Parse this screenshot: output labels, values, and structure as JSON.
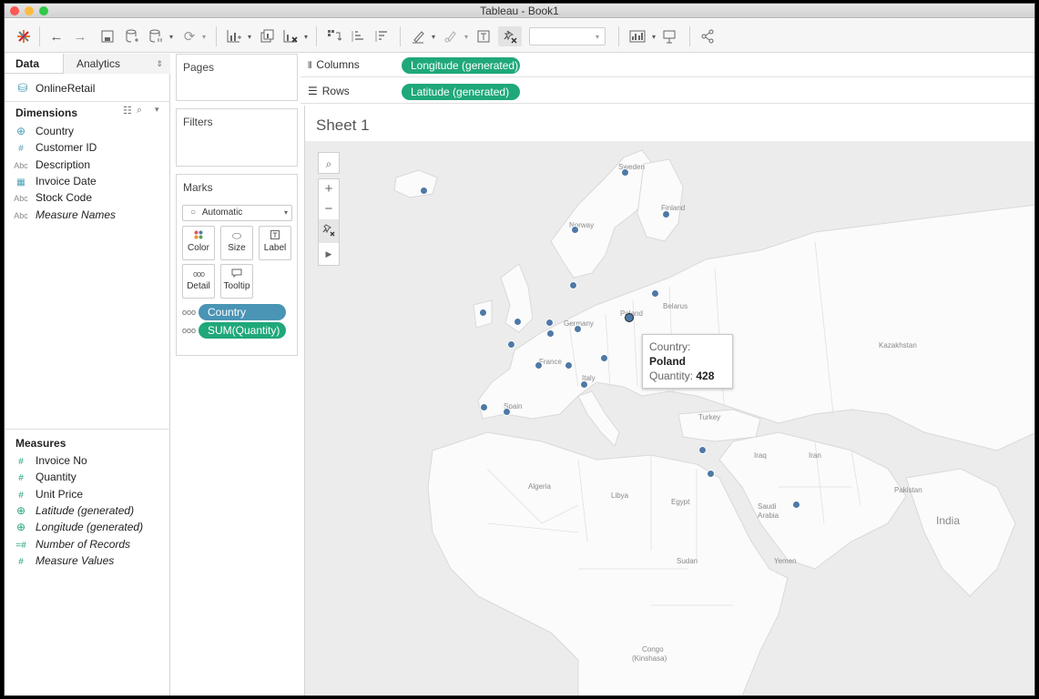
{
  "window": {
    "title": "Tableau - Book1"
  },
  "left": {
    "tabs": {
      "data": "Data",
      "analytics": "Analytics"
    },
    "datasource": "OnlineRetail",
    "dimensions_title": "Dimensions",
    "dimensions": [
      {
        "icon": "globe-icon",
        "type": "⊕",
        "label": "Country",
        "italic": false
      },
      {
        "icon": "number-icon",
        "type": "#",
        "label": "Customer ID",
        "italic": false
      },
      {
        "icon": "text-icon",
        "type": "Abc",
        "label": "Description",
        "italic": false
      },
      {
        "icon": "date-icon",
        "type": "▦",
        "label": "Invoice Date",
        "italic": false
      },
      {
        "icon": "text-icon",
        "type": "Abc",
        "label": "Stock Code",
        "italic": false
      },
      {
        "icon": "text-icon",
        "type": "Abc",
        "label": "Measure Names",
        "italic": true
      }
    ],
    "measures_title": "Measures",
    "measures": [
      {
        "icon": "number-icon",
        "type": "#",
        "label": "Invoice No",
        "italic": false
      },
      {
        "icon": "number-icon",
        "type": "#",
        "label": "Quantity",
        "italic": false
      },
      {
        "icon": "number-icon",
        "type": "#",
        "label": "Unit Price",
        "italic": false
      },
      {
        "icon": "globe-icon",
        "type": "⊕",
        "label": "Latitude (generated)",
        "italic": true
      },
      {
        "icon": "globe-icon",
        "type": "⊕",
        "label": "Longitude (generated)",
        "italic": true
      },
      {
        "icon": "number-icon",
        "type": "=#",
        "label": "Number of Records",
        "italic": true
      },
      {
        "icon": "number-icon",
        "type": "#",
        "label": "Measure Values",
        "italic": true
      }
    ]
  },
  "cards": {
    "pages": "Pages",
    "filters": "Filters",
    "marks": "Marks",
    "mark_type": "Automatic",
    "buttons": {
      "color": "Color",
      "size": "Size",
      "label": "Label",
      "detail": "Detail",
      "tooltip": "Tooltip"
    },
    "pills": {
      "country": "Country",
      "quantity": "SUM(Quantity)"
    }
  },
  "shelves": {
    "columns_label": "Columns",
    "columns_pill": "Longitude (generated)",
    "rows_label": "Rows",
    "rows_pill": "Latitude (generated)"
  },
  "sheet": {
    "title": "Sheet 1"
  },
  "map": {
    "labels": [
      "Sweden",
      "Finland",
      "Norway",
      "Belarus",
      "Germany",
      "Poland",
      "France",
      "Italy",
      "Spain",
      "Kazakhstan",
      "Turkey",
      "Iraq",
      "Iran",
      "Algeria",
      "Libya",
      "Egypt",
      "Saudi",
      "Arabia",
      "Pakistan",
      "India",
      "Sudan",
      "Yemen",
      "Congo",
      "(Kinshasa)"
    ],
    "point_color": "#4e79a7"
  },
  "tooltip": {
    "country_label": "Country:",
    "country_value": "Poland",
    "quantity_label": "Quantity:",
    "quantity_value": "428"
  }
}
